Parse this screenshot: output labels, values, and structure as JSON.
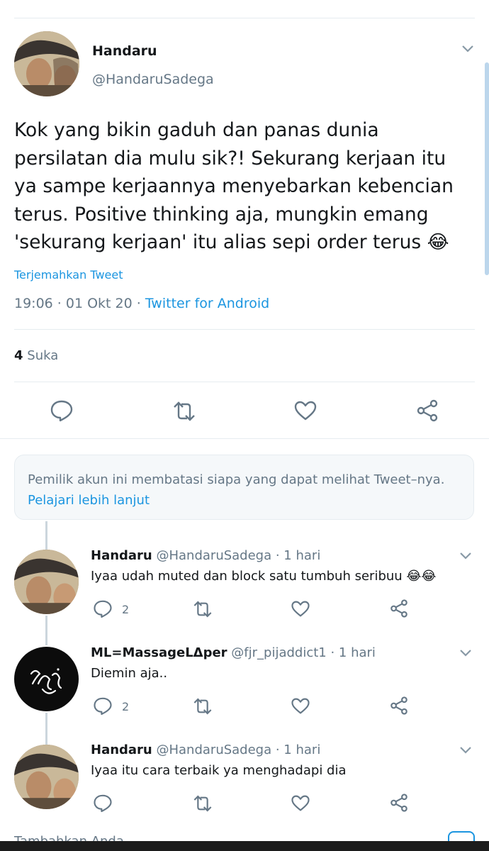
{
  "main_tweet": {
    "name": "Handaru",
    "handle": "@HandaruSadega",
    "text_lines": [
      "Kok yang bikin gaduh dan panas dunia",
      "persilatan dia mulu sik?! Sekurang kerjaan itu",
      "ya sampe kerjaannya menyebarkan kebencian",
      "terus. Positive thinking aja, mungkin emang",
      "'sekurang kerjaan' itu alias sepi order terus 😂"
    ],
    "translate_label": "Terjemahkan Tweet",
    "timestamp": "19:06 · 01 Okt 20 · ",
    "client": "Twitter for Android",
    "likes_count": "4",
    "likes_label": "Suka"
  },
  "notice": {
    "text": "Pemilik akun ini membatasi siapa yang dapat melihat Tweet–nya. ",
    "link": "Pelajari lebih lanjut"
  },
  "replies": [
    {
      "name": "Handaru",
      "meta": "@HandaruSadega · 1 hari",
      "text": "Iyaa udah muted dan block satu tumbuh seribuu 😂😂",
      "reply_count": "2",
      "avatar": "photo"
    },
    {
      "name": "ML=MassageLΔper",
      "meta": "@fjr_pijaddict1 · 1 hari",
      "text": "Diemin aja..",
      "reply_count": "2",
      "avatar": "dark"
    },
    {
      "name": "Handaru",
      "meta": "@HandaruSadega · 1 hari",
      "text": "Iyaa itu cara terbaik ya menghadapi dia",
      "reply_count": "",
      "avatar": "photo"
    }
  ],
  "bottom_partial_text": "Tambahkan Anda...",
  "icons": {
    "menu": "chevron-down-icon",
    "reply": "reply-icon",
    "retweet": "retweet-icon",
    "like": "heart-icon",
    "share": "share-icon"
  },
  "colors": {
    "accent": "#1b95e0",
    "icon_grey": "#657786",
    "text": "#14171a"
  }
}
